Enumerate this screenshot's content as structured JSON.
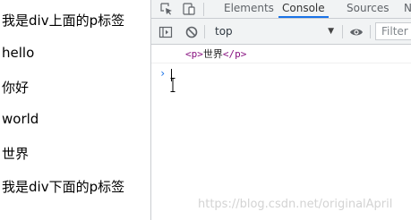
{
  "page": {
    "lines": [
      "我是div上面的p标签",
      "hello",
      "你好",
      "world",
      "世界",
      "我是div下面的p标签"
    ]
  },
  "devtools": {
    "tabs": [
      {
        "label": "Elements",
        "active": false
      },
      {
        "label": "Console",
        "active": true
      },
      {
        "label": "Sources",
        "active": false
      },
      {
        "label": "N",
        "active": false
      }
    ],
    "toolbar": {
      "context": "top",
      "filter_placeholder": "Filter"
    },
    "console": {
      "log_open_tag": "<p>",
      "log_text": "世界",
      "log_close_tag": "</p>",
      "prompt_symbol": "›"
    },
    "icons": [
      "inspect-element-icon",
      "device-toggle-icon",
      "sidebar-toggle-icon",
      "clear-console-icon",
      "dropdown-arrow-icon",
      "eye-icon"
    ]
  },
  "watermark": "https://blog.csdn.net/originalApril",
  "colors": {
    "active_tab_underline": "#1a73e8",
    "tag_color": "#881280",
    "panel_bg": "#f1f3f4",
    "border": "#cacdd1"
  }
}
